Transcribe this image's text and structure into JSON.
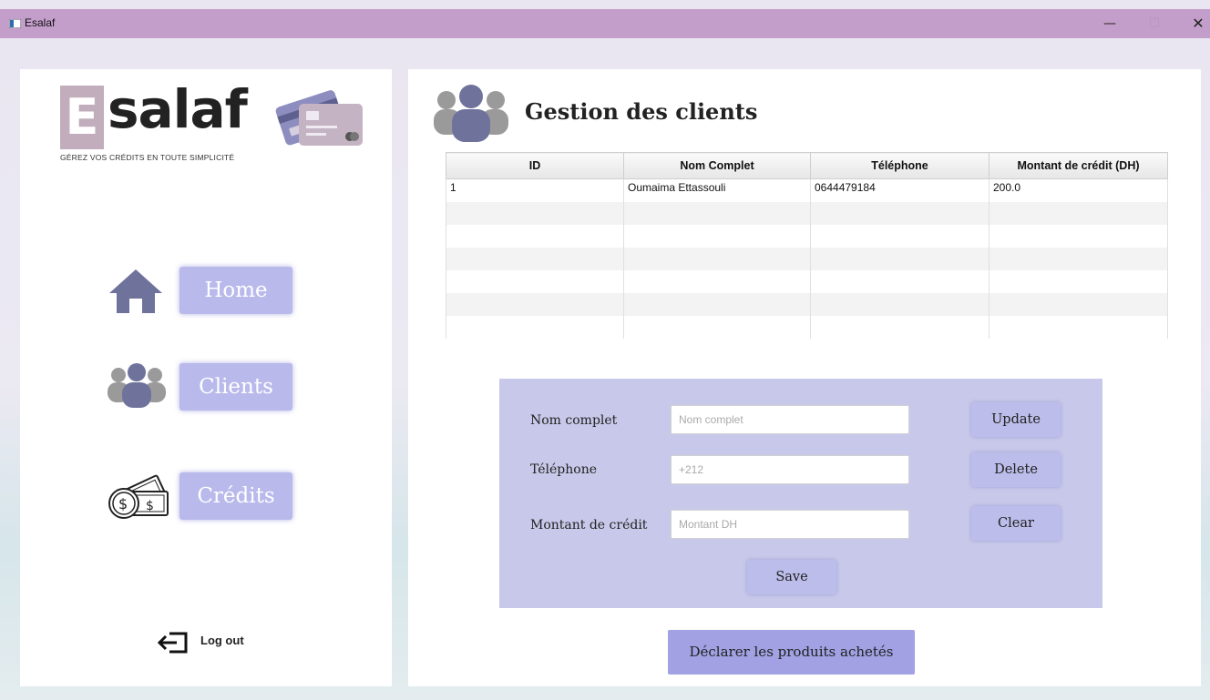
{
  "window": {
    "title": "Esalaf",
    "minimize": "—",
    "maximize": "☐",
    "close": "✕"
  },
  "brand": {
    "letter": "E",
    "word": "salaf",
    "tagline": "GÉREZ VOS CRÉDITS EN TOUTE SIMPLICITÉ"
  },
  "nav": {
    "home": "Home",
    "clients": "Clients",
    "credits": "Crédits",
    "logout": "Log out"
  },
  "page": {
    "title": "Gestion des clients"
  },
  "table": {
    "headers": [
      "ID",
      "Nom Complet",
      "Téléphone",
      "Montant de crédit (DH)"
    ],
    "rows": [
      [
        "1",
        "Oumaima Ettassouli",
        "0644479184",
        "200.0"
      ]
    ]
  },
  "form": {
    "name_label": "Nom complet",
    "name_placeholder": "Nom complet",
    "phone_label": "Téléphone",
    "phone_placeholder": "+212",
    "amount_label": "Montant de crédit",
    "amount_placeholder": "Montant DH",
    "update": "Update",
    "delete": "Delete",
    "clear": "Clear",
    "save": "Save"
  },
  "declare_button": "Déclarer les produits achetés",
  "icons": {
    "app": "app-window-icon",
    "clients": "users-group-icon",
    "home": "home-icon",
    "credits": "money-icon",
    "logout": "logout-icon",
    "cards": "credit-cards-icon"
  },
  "colors": {
    "titlebar": "#c49ecb",
    "nav_button": "#b9b9ec",
    "form_panel": "#c8c9ea",
    "declare_button": "#a1a1e3",
    "icon_accent": "#6f739c"
  }
}
